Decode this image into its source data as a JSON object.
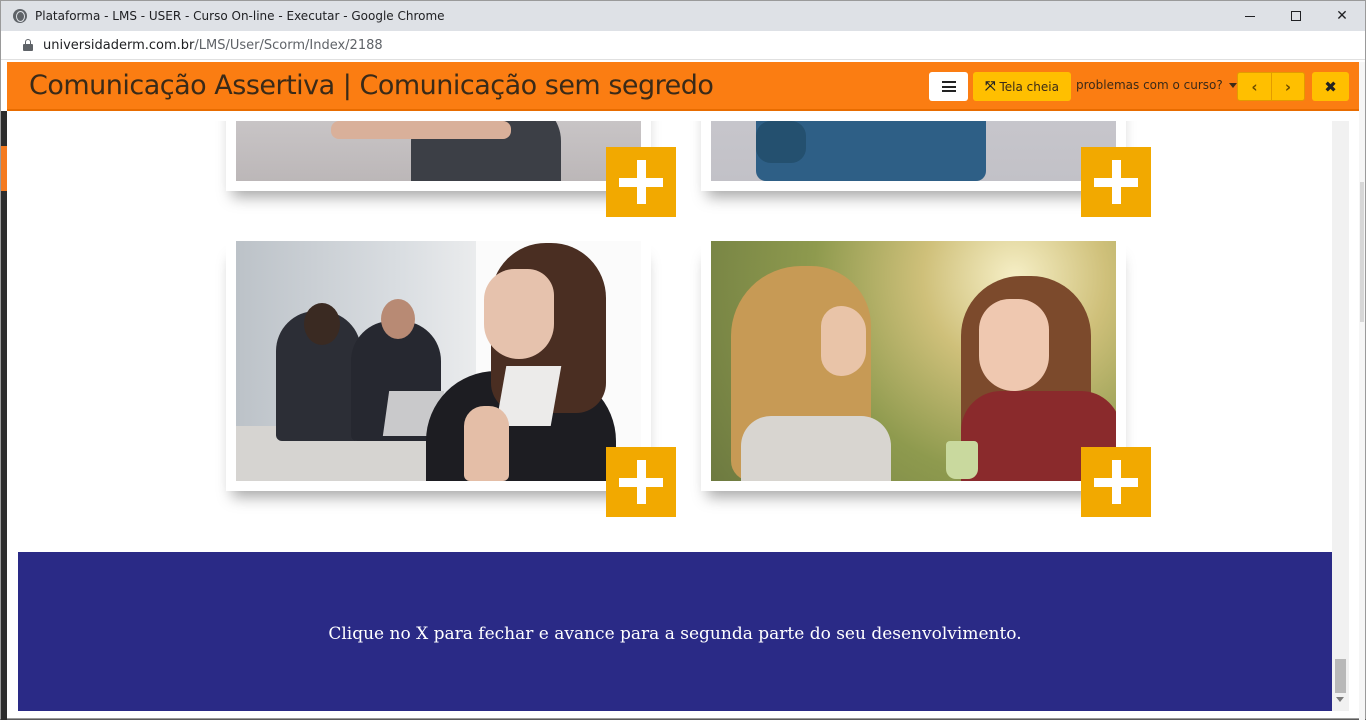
{
  "browser": {
    "window_title": "Plataforma - LMS - USER - Curso On-line - Executar - Google Chrome",
    "url_host": "universidaderm.com.br",
    "url_path": "/LMS/User/Scorm/Index/2188"
  },
  "header": {
    "course_title": "Comunicação Assertiva | Comunicação sem segredo",
    "fullscreen_label": "Tela cheia",
    "problems_label": "problemas com o curso?",
    "prev_glyph": "‹",
    "next_glyph": "›",
    "close_glyph": "✖"
  },
  "content": {
    "cards": [
      {
        "name": "card-top-left",
        "icon": "plus-icon"
      },
      {
        "name": "card-top-right",
        "icon": "plus-icon"
      },
      {
        "name": "card-meditation",
        "icon": "plus-icon"
      },
      {
        "name": "card-conversation",
        "icon": "plus-icon"
      }
    ],
    "footer_message": "Clique no X para fechar e avance para a segunda parte do seu desenvolvimento."
  },
  "colors": {
    "header_orange": "#fb7d12",
    "button_yellow": "#ffbf00",
    "plus_yellow": "#f2a900",
    "band_blue": "#2a2a86"
  }
}
